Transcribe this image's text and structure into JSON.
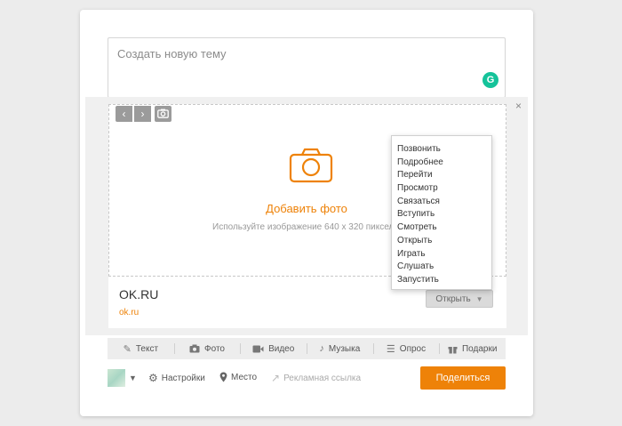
{
  "composer": {
    "topic_placeholder": "Создать новую тему",
    "grammarly_badge": "G"
  },
  "media": {
    "close": "×",
    "prev": "‹",
    "next": "›",
    "add_photo": "Добавить фото",
    "hint": "Используйте изображение 640 x 320 пикселей"
  },
  "link": {
    "title": "OK.RU",
    "url": "ok.ru",
    "open_button": "Открыть",
    "caret": "▼"
  },
  "dropdown_items": [
    "Позвонить",
    "Подробнее",
    "Перейти",
    "Просмотр",
    "Связаться",
    "Вступить",
    "Смотреть",
    "Открыть",
    "Играть",
    "Слушать",
    "Запустить"
  ],
  "tabs": [
    {
      "label": "Текст",
      "icon": "pencil-icon"
    },
    {
      "label": "Фото",
      "icon": "camera-icon"
    },
    {
      "label": "Видео",
      "icon": "video-icon"
    },
    {
      "label": "Музыка",
      "icon": "music-icon"
    },
    {
      "label": "Опрос",
      "icon": "poll-icon"
    },
    {
      "label": "Подарки",
      "icon": "gift-icon"
    }
  ],
  "bottom": {
    "avatar_caret": "▼",
    "settings": "Настройки",
    "place": "Место",
    "ad_link": "Рекламная ссылка",
    "share": "Поделиться"
  },
  "colors": {
    "accent": "#ee8208",
    "grammarly": "#15c39a"
  }
}
